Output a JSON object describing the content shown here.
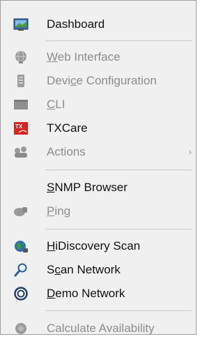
{
  "menu": {
    "items": [
      {
        "label_parts": [
          "Dashboard"
        ],
        "icon": "dashboard-icon",
        "enabled": true
      },
      {
        "label_parts": [
          "",
          "W",
          "eb Interface"
        ],
        "icon": "globe-icon",
        "enabled": false
      },
      {
        "label_parts": [
          "Devi",
          "c",
          "e Configuration"
        ],
        "icon": "device-config-icon",
        "enabled": false
      },
      {
        "label_parts": [
          "",
          "C",
          "LI"
        ],
        "icon": "cli-terminal-icon",
        "enabled": false
      },
      {
        "label_parts": [
          "TXCare"
        ],
        "icon": "txcare-icon",
        "icon_text": "TX",
        "enabled": true
      },
      {
        "label_parts": [
          "Actions"
        ],
        "icon": "actions-icon",
        "enabled": false,
        "submenu_arrow": "›"
      },
      {
        "label_parts": [
          "",
          "S",
          "NMP Browser"
        ],
        "icon": "none",
        "enabled": true
      },
      {
        "label_parts": [
          "",
          "P",
          "ing"
        ],
        "icon": "ping-icon",
        "enabled": false
      },
      {
        "label_parts": [
          "",
          "H",
          "iDiscovery Scan"
        ],
        "icon": "hidiscovery-globe-icon",
        "enabled": true
      },
      {
        "label_parts": [
          "S",
          "c",
          "an Network"
        ],
        "icon": "magnifier-icon",
        "enabled": true
      },
      {
        "label_parts": [
          "",
          "D",
          "emo Network"
        ],
        "icon": "demo-network-icon",
        "enabled": true
      },
      {
        "label_parts": [
          "Calculate Availability"
        ],
        "icon": "calculate-icon",
        "enabled": false
      }
    ]
  },
  "colors": {
    "enabled_text": "#111111",
    "disabled_text": "#8c8c8c",
    "txcare_red": "#d9231f"
  }
}
